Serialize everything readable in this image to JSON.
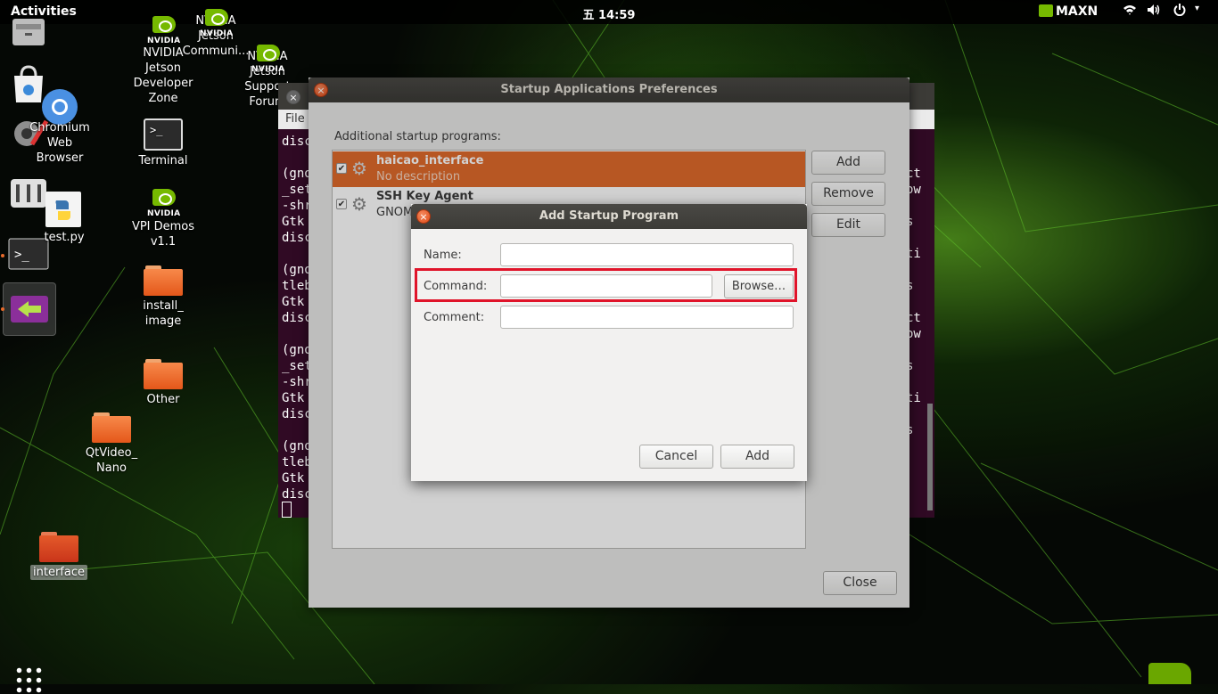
{
  "topbar": {
    "activities": "Activities",
    "clock": "五 14:59",
    "power_mode": "MAXN",
    "wifi_icon": "wifi-icon",
    "volume_icon": "volume-icon",
    "power_icon": "power-icon"
  },
  "desktop": {
    "icons": [
      {
        "label": "NVIDIA\nJetson\nDeveloper\nZone"
      },
      {
        "label": "NVIDIA\nJetson\nCommuni..."
      },
      {
        "label": "NVIDIA\nJetson\nSupport\nForum"
      },
      {
        "label": "Chromium\nWeb\nBrowser"
      },
      {
        "label": "Terminal"
      },
      {
        "label": "test.py"
      },
      {
        "label": "VPI Demos\nv1.1"
      },
      {
        "label": "install_\nimage"
      },
      {
        "label": "Other"
      },
      {
        "label": "QtVideo_\nNano"
      },
      {
        "label": "interface"
      }
    ]
  },
  "terminal": {
    "menu_file": "File",
    "lines": [
      "disc",
      "",
      "(gno",
      "_set",
      "-shr",
      "Gtk",
      "disc",
      "",
      "(gno",
      "tleb",
      "Gtk",
      "disc",
      "",
      "(gno",
      "_set",
      "-shr",
      "Gtk",
      "disc",
      "",
      "(gno",
      "tleb",
      "Gtk",
      "disc"
    ],
    "right_lines": [
      "ct",
      "ow",
      "",
      "s",
      "",
      "ti",
      "",
      "s",
      "",
      "ct",
      "ow",
      "",
      "s",
      "",
      "ti",
      "",
      "s"
    ]
  },
  "prefs": {
    "title": "Startup Applications Preferences",
    "section_label": "Additional startup programs:",
    "programs": [
      {
        "name": "haicao_interface",
        "description": "No description",
        "checked": true,
        "selected": true
      },
      {
        "name": "SSH Key Agent",
        "description": "GNOM",
        "checked": true,
        "selected": false
      }
    ],
    "add_label": "Add",
    "remove_label": "Remove",
    "edit_label": "Edit",
    "close_label": "Close"
  },
  "dialog": {
    "title": "Add Startup Program",
    "name_label": "Name:",
    "name_value": "",
    "command_label": "Command:",
    "command_value": "",
    "browse_label": "Browse…",
    "comment_label": "Comment:",
    "comment_value": "",
    "cancel_label": "Cancel",
    "add_label": "Add"
  },
  "colors": {
    "accent": "#e06b2b",
    "highlight": "#e0142a",
    "nvidia_green": "#76b900",
    "terminal_bg": "#300a24"
  }
}
